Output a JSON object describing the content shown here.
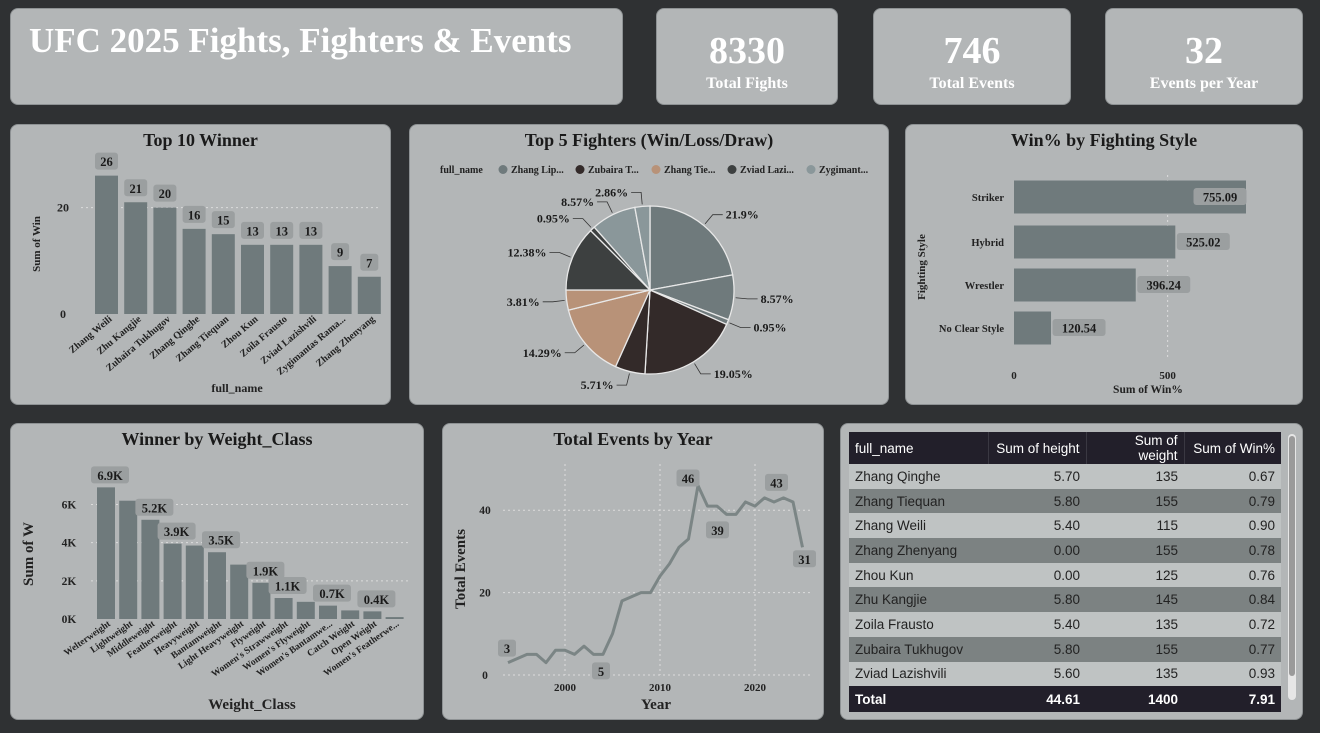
{
  "dashboard": {
    "title": "UFC 2025 Fights, Fighters & Events",
    "kpis": [
      {
        "value": "8330",
        "label": "Total Fights"
      },
      {
        "value": "746",
        "label": "Total Events"
      },
      {
        "value": "32",
        "label": "Events per Year"
      }
    ]
  },
  "colors": {
    "card_bg": "#b3b6b7",
    "bar": "#6f7a7c",
    "page_bg": "#2f3133",
    "pie": [
      "#6f7a7c",
      "#332a29",
      "#b89278",
      "#3d4040",
      "#8a979a"
    ]
  },
  "chart_data": [
    {
      "type": "bar",
      "title": "Top 10 Winner",
      "xlabel": "full_name",
      "ylabel": "Sum of Win",
      "categories": [
        "Zhang Weili",
        "Zhu Kangjie",
        "Zubaira Tukhugov",
        "Zhang Qinghe",
        "Zhang Tiequan",
        "Zhou Kun",
        "Zoila Frausto",
        "Zviad Lazishvili",
        "Zygimantas Rama...",
        "Zhang Zhenyang"
      ],
      "values": [
        26,
        21,
        20,
        16,
        15,
        13,
        13,
        13,
        9,
        7
      ],
      "data_labels": [
        "26",
        "21",
        "20",
        "16",
        "15",
        "13",
        "13",
        "13",
        "9",
        "7"
      ],
      "yticks": [
        "0",
        "20"
      ],
      "ylim": [
        0,
        28
      ]
    },
    {
      "type": "pie",
      "title": "Top 5 Fighters (Win/Loss/Draw)",
      "legend_title": "full_name",
      "legend": [
        "Zhang Lip...",
        "Zubaira T...",
        "Zhang Tie...",
        "Zviad Lazi...",
        "Zygimant..."
      ],
      "slices": [
        {
          "fighter": 0,
          "value": 21.9,
          "label": "21.9%"
        },
        {
          "fighter": 0,
          "value": 8.57,
          "label": "8.57%"
        },
        {
          "fighter": 0,
          "value": 0.95,
          "label": "0.95%"
        },
        {
          "fighter": 1,
          "value": 19.05,
          "label": "19.05%"
        },
        {
          "fighter": 1,
          "value": 5.71,
          "label": "5.71%"
        },
        {
          "fighter": 2,
          "value": 14.29,
          "label": "14.29%"
        },
        {
          "fighter": 2,
          "value": 3.81,
          "label": "3.81%"
        },
        {
          "fighter": 3,
          "value": 12.38,
          "label": "12.38%"
        },
        {
          "fighter": 3,
          "value": 0.95,
          "label": "0.95%"
        },
        {
          "fighter": 4,
          "value": 8.57,
          "label": "8.57%"
        },
        {
          "fighter": 4,
          "value": 2.86,
          "label": "2.86%"
        }
      ]
    },
    {
      "type": "bar",
      "orientation": "horizontal",
      "title": "Win% by Fighting Style",
      "xlabel": "Sum of Win%",
      "ylabel": "Fighting Style",
      "categories": [
        "Striker",
        "Hybrid",
        "Wrestler",
        "No Clear Style"
      ],
      "values": [
        755.09,
        525.02,
        396.24,
        120.54
      ],
      "data_labels": [
        "755.09",
        "525.02",
        "396.24",
        "120.54"
      ],
      "xticks": [
        "0",
        "500"
      ],
      "xlim": [
        0,
        755.09
      ]
    },
    {
      "type": "bar",
      "title": "Winner by Weight_Class",
      "xlabel": "Weight_Class",
      "ylabel": "Sum of W",
      "categories": [
        "Welterweight",
        "Lightweight",
        "Middleweight",
        "Featherweight",
        "Heavyweight",
        "Bantamweight",
        "Light Heavyweight",
        "Flyweight",
        "Women's Strawweight",
        "Women's Flyweight",
        "Women's Bantamwe...",
        "Catch Weight",
        "Open Weight",
        "Women's Featherwe..."
      ],
      "values": [
        6.9,
        6.2,
        5.2,
        3.95,
        3.85,
        3.5,
        2.85,
        1.9,
        1.1,
        0.9,
        0.7,
        0.45,
        0.4,
        0.1
      ],
      "data_labels": [
        "6.9K",
        "",
        "5.2K",
        "3.9K",
        "",
        "3.5K",
        "",
        "1.9K",
        "1.1K",
        "",
        "0.7K",
        "",
        "0.4K",
        ""
      ],
      "yticks": [
        "0K",
        "2K",
        "4K",
        "6K"
      ],
      "ylim": [
        0,
        7.6
      ]
    },
    {
      "type": "line",
      "title": "Total Events by Year",
      "xlabel": "Year",
      "ylabel": "Total Events",
      "x": [
        1994,
        1995,
        1996,
        1997,
        1998,
        1999,
        2000,
        2001,
        2002,
        2003,
        2004,
        2005,
        2006,
        2007,
        2008,
        2009,
        2010,
        2011,
        2012,
        2013,
        2014,
        2015,
        2016,
        2017,
        2018,
        2019,
        2020,
        2021,
        2022,
        2023,
        2024,
        2025
      ],
      "y": [
        3,
        4,
        5,
        5,
        3,
        6,
        6,
        5,
        7,
        5,
        5,
        10,
        18,
        19,
        20,
        20,
        24,
        27,
        31,
        33,
        46,
        41,
        41,
        39,
        39,
        42,
        41,
        43,
        42,
        43,
        42,
        31
      ],
      "point_labels": [
        {
          "x": 1994,
          "text": "3"
        },
        {
          "x": 2004,
          "text": "5"
        },
        {
          "x": 2014,
          "text": "46"
        },
        {
          "x": 2017,
          "text": "39"
        },
        {
          "x": 2021,
          "text": "43"
        },
        {
          "x": 2025,
          "text": "31"
        }
      ],
      "xticks": [
        "2000",
        "2010",
        "2020"
      ],
      "yticks": [
        "0",
        "20",
        "40"
      ],
      "ylim": [
        0,
        50
      ]
    }
  ],
  "table": {
    "columns": [
      "full_name",
      "Sum of height",
      "Sum of weight",
      "Sum of Win%"
    ],
    "rows": [
      [
        "Zhang Qinghe",
        "5.70",
        "135",
        "0.67"
      ],
      [
        "Zhang Tiequan",
        "5.80",
        "155",
        "0.79"
      ],
      [
        "Zhang Weili",
        "5.40",
        "115",
        "0.90"
      ],
      [
        "Zhang Zhenyang",
        "0.00",
        "155",
        "0.78"
      ],
      [
        "Zhou Kun",
        "0.00",
        "125",
        "0.76"
      ],
      [
        "Zhu Kangjie",
        "5.80",
        "145",
        "0.84"
      ],
      [
        "Zoila Frausto",
        "5.40",
        "135",
        "0.72"
      ],
      [
        "Zubaira Tukhugov",
        "5.80",
        "155",
        "0.77"
      ],
      [
        "Zviad Lazishvili",
        "5.60",
        "135",
        "0.93"
      ]
    ],
    "total": [
      "Total",
      "44.61",
      "1400",
      "7.91"
    ]
  }
}
